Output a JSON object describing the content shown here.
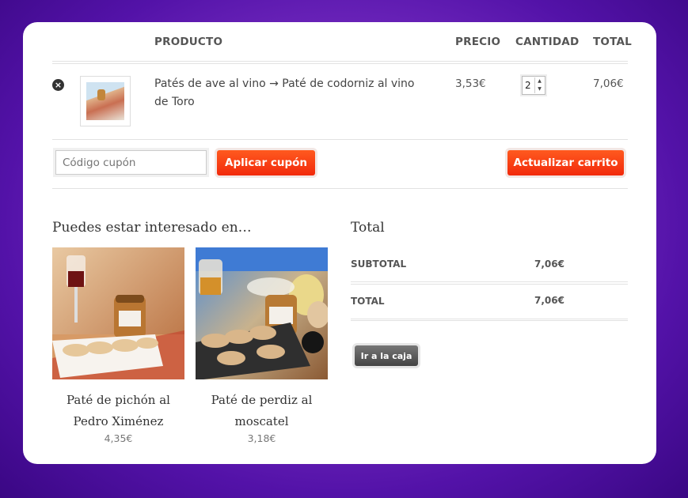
{
  "table": {
    "headers": [
      "PRODUCTO",
      "PRECIO",
      "CANTIDAD",
      "TOTAL"
    ]
  },
  "cart_item": {
    "remove_icon": "close-icon",
    "name": "Patés de ave al vino → Paté de codorniz al vino de Toro",
    "price": "3,53€",
    "quantity": "2",
    "total": "7,06€"
  },
  "actions": {
    "coupon_placeholder": "Código cupón",
    "apply_coupon": "Aplicar cupón",
    "update_cart": "Actualizar carrito"
  },
  "cross_sells": {
    "title": "Puedes estar interesado en…",
    "items": [
      {
        "name": "Paté de pichón al Pedro Ximénez",
        "price": "4,35€"
      },
      {
        "name": "Paté de perdiz al moscatel",
        "price": "3,18€"
      }
    ]
  },
  "totals": {
    "title": "Total",
    "subtotal_label": "SUBTOTAL",
    "subtotal_value": "7,06€",
    "total_label": "TOTAL",
    "total_value": "7,06€",
    "checkout": "Ir a la caja"
  },
  "colors": {
    "accent": "#f2290b",
    "background": "#6a1fb8"
  }
}
